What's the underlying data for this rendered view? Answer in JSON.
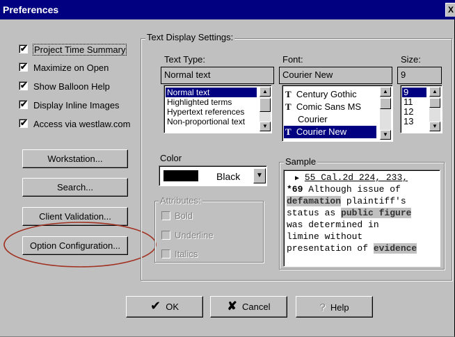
{
  "window": {
    "title": "Preferences",
    "close_label": "X"
  },
  "options": [
    {
      "label": "Project Time Summary",
      "checked": true
    },
    {
      "label": "Maximize on Open",
      "checked": true
    },
    {
      "label": "Show Balloon Help",
      "checked": true
    },
    {
      "label": "Display Inline Images",
      "checked": true
    },
    {
      "label": "Access via westlaw.com",
      "checked": true
    }
  ],
  "left_buttons": {
    "workstation": "Workstation...",
    "search": "Search...",
    "client_validation": "Client Validation...",
    "option_configuration": "Option Configuration..."
  },
  "text_display": {
    "group_label": "Text Display Settings:",
    "text_type_label": "Text Type:",
    "text_type_value": "Normal text",
    "text_types": [
      "Normal text",
      "Highlighted terms",
      "Hypertext references",
      "Non-proportional text"
    ],
    "font_label": "Font:",
    "font_value": "Courier New",
    "fonts": [
      "Century Gothic",
      "Comic Sans MS",
      "Courier",
      "Courier New"
    ],
    "size_label": "Size:",
    "size_value": "9",
    "sizes": [
      "9",
      "11",
      "12",
      "13"
    ],
    "color_label": "Color",
    "color_value": "Black",
    "color_swatch": "#000000",
    "attributes_label": "Attributes:",
    "attributes": [
      "Bold",
      "Underline",
      "Italics"
    ],
    "sample_label": "Sample",
    "sample_lines": {
      "l1": "55 Cal.2d 224, 233,",
      "l2a": "*69",
      "l2b": " Although issue of",
      "l3a": "defamation",
      "l3b": " plaintiff's",
      "l4a": "status as ",
      "l4b": "public figure",
      "l5": "was determined in",
      "l6": "limine without",
      "l7a": "presentation of ",
      "l7b": "evidence"
    }
  },
  "footer": {
    "ok": "OK",
    "cancel": "Cancel",
    "help": "Help"
  },
  "annotation_color": "#a03020",
  "icons": [
    "checkmark-icon",
    "truetype-font-icon",
    "ok-check-icon",
    "cancel-x-icon",
    "help-question-icon",
    "arrow-up-icon",
    "arrow-down-icon"
  ]
}
